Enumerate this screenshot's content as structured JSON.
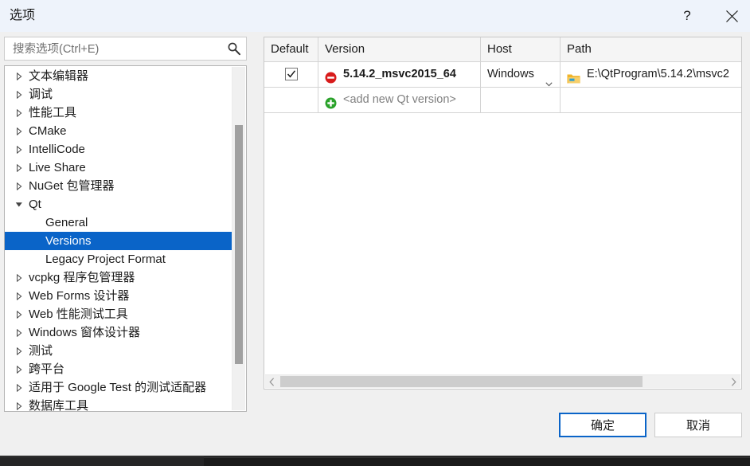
{
  "window": {
    "title": "选项",
    "help_label": "?",
    "close_label": "×",
    "help_icon": "question-mark-icon",
    "close_icon": "close-x-icon"
  },
  "search": {
    "placeholder": "搜索选项(Ctrl+E)",
    "value": "",
    "icon": "search-icon"
  },
  "tree": {
    "items": [
      {
        "label": "文本编辑器",
        "level": 0,
        "expandable": true,
        "expanded": false,
        "selected": false
      },
      {
        "label": "调试",
        "level": 0,
        "expandable": true,
        "expanded": false,
        "selected": false
      },
      {
        "label": "性能工具",
        "level": 0,
        "expandable": true,
        "expanded": false,
        "selected": false
      },
      {
        "label": "CMake",
        "level": 0,
        "expandable": true,
        "expanded": false,
        "selected": false
      },
      {
        "label": "IntelliCode",
        "level": 0,
        "expandable": true,
        "expanded": false,
        "selected": false
      },
      {
        "label": "Live Share",
        "level": 0,
        "expandable": true,
        "expanded": false,
        "selected": false
      },
      {
        "label": "NuGet 包管理器",
        "level": 0,
        "expandable": true,
        "expanded": false,
        "selected": false
      },
      {
        "label": "Qt",
        "level": 0,
        "expandable": true,
        "expanded": true,
        "selected": false
      },
      {
        "label": "General",
        "level": 1,
        "expandable": false,
        "expanded": false,
        "selected": false
      },
      {
        "label": "Versions",
        "level": 1,
        "expandable": false,
        "expanded": false,
        "selected": true
      },
      {
        "label": "Legacy Project Format",
        "level": 1,
        "expandable": false,
        "expanded": false,
        "selected": false
      },
      {
        "label": "vcpkg 程序包管理器",
        "level": 0,
        "expandable": true,
        "expanded": false,
        "selected": false
      },
      {
        "label": "Web Forms 设计器",
        "level": 0,
        "expandable": true,
        "expanded": false,
        "selected": false
      },
      {
        "label": "Web 性能测试工具",
        "level": 0,
        "expandable": true,
        "expanded": false,
        "selected": false
      },
      {
        "label": "Windows 窗体设计器",
        "level": 0,
        "expandable": true,
        "expanded": false,
        "selected": false
      },
      {
        "label": "测试",
        "level": 0,
        "expandable": true,
        "expanded": false,
        "selected": false
      },
      {
        "label": "跨平台",
        "level": 0,
        "expandable": true,
        "expanded": false,
        "selected": false
      },
      {
        "label": "适用于 Google Test 的测试适配器",
        "level": 0,
        "expandable": true,
        "expanded": false,
        "selected": false
      },
      {
        "label": "数据库工具",
        "level": 0,
        "expandable": true,
        "expanded": false,
        "selected": false
      }
    ],
    "selected_label": "Versions"
  },
  "grid": {
    "columns": [
      {
        "label": "Default"
      },
      {
        "label": "Version"
      },
      {
        "label": "Host"
      },
      {
        "label": "Path"
      }
    ],
    "rows": [
      {
        "default_checked": true,
        "version": "5.14.2_msvc2015_64",
        "version_status_icon": "error-circle-icon",
        "host": "Windows",
        "host_dropdown_icon": "chevron-down-icon",
        "path": "E:\\QtProgram\\5.14.2\\msvc2",
        "path_icon": "folder-icon",
        "is_add_row": false
      },
      {
        "default_checked": false,
        "version": "<add new Qt version>",
        "version_status_icon": "add-circle-icon",
        "host": "",
        "host_dropdown_icon": "",
        "path": "",
        "path_icon": "",
        "is_add_row": true
      }
    ],
    "scroll_left_icon": "chevron-left-icon",
    "scroll_right_icon": "chevron-right-icon"
  },
  "footer": {
    "ok_label": "确定",
    "cancel_label": "取消"
  },
  "colors": {
    "accent": "#0a64c8",
    "titlebar": "#eef3fb",
    "error": "#d81b1b",
    "add": "#27ae27",
    "folder": "#f5c242"
  }
}
